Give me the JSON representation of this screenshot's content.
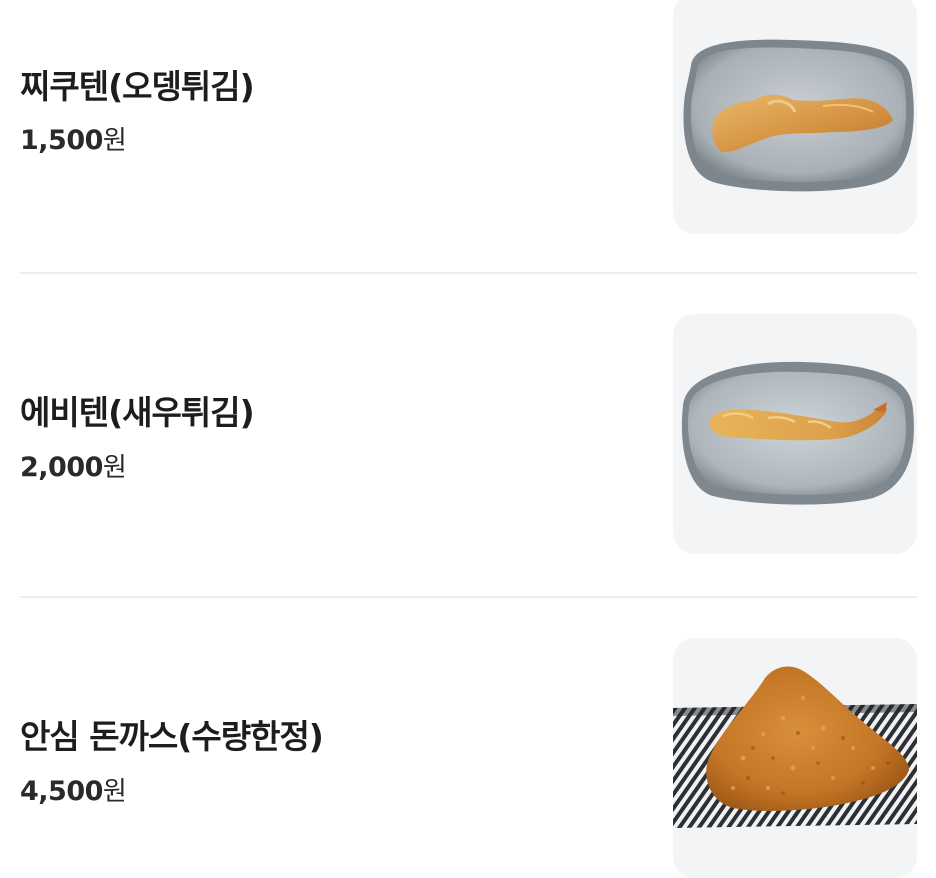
{
  "menu": {
    "items": [
      {
        "name": "찌쿠텐(오뎅튀김)",
        "price": "1,500",
        "unit": "원",
        "image_icon": "fried-fishcake-image"
      },
      {
        "name": "에비텐(새우튀김)",
        "price": "2,000",
        "unit": "원",
        "image_icon": "fried-shrimp-image"
      },
      {
        "name": "안심 돈까스(수량한정)",
        "price": "4,500",
        "unit": "원",
        "image_icon": "pork-cutlet-image"
      }
    ]
  },
  "colors": {
    "text": "#1d1d1d",
    "thumb_bg": "#f3f4f6",
    "divider": "#eeeeee",
    "plate": "#9aa3aa",
    "fried": "#d99a45"
  }
}
